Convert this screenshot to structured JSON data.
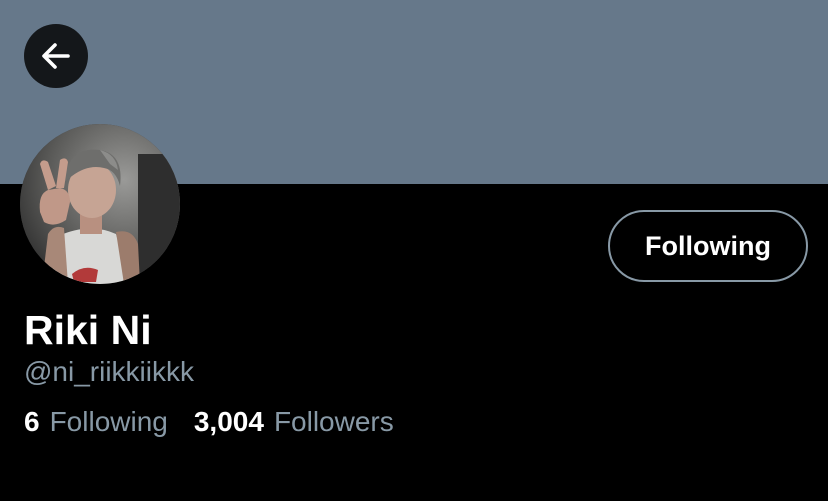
{
  "profile": {
    "display_name": "Riki Ni",
    "handle": "@ni_riikkiikkk",
    "follow_button_label": "Following",
    "stats": {
      "following_count": "6",
      "following_label": "Following",
      "followers_count": "3,004",
      "followers_label": "Followers"
    }
  },
  "icons": {
    "back": "arrow-left-icon"
  },
  "colors": {
    "banner": "#66788a",
    "background": "#000000",
    "secondary_text": "#8899a6",
    "primary_text": "#ffffff"
  }
}
